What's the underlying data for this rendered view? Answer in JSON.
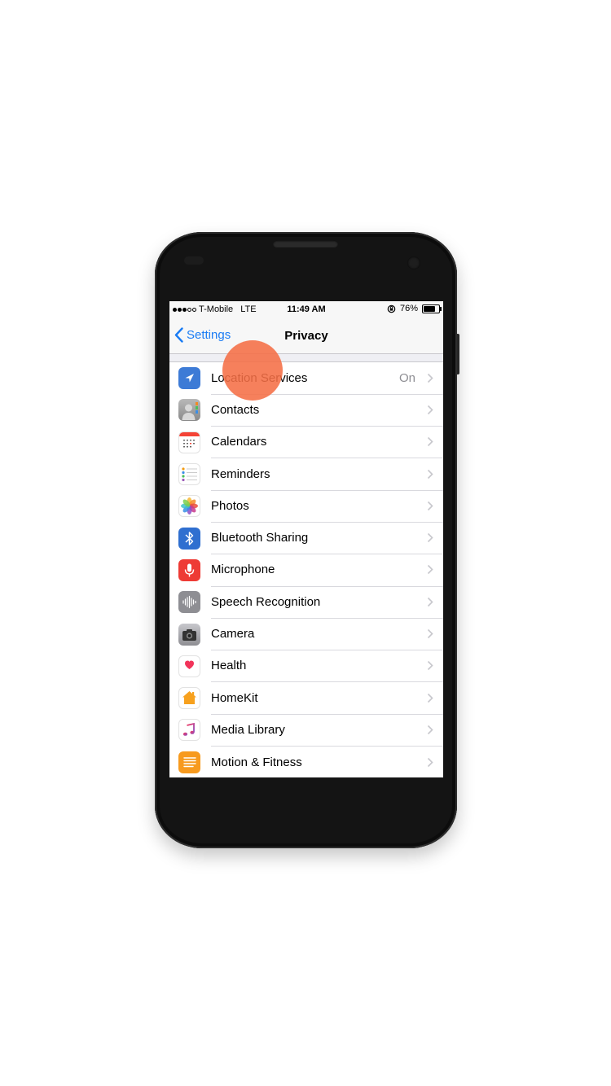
{
  "status_bar": {
    "carrier": "T-Mobile",
    "network": "LTE",
    "time": "11:49 AM",
    "battery": "76%"
  },
  "nav": {
    "back_label": "Settings",
    "title": "Privacy"
  },
  "rows": [
    {
      "label": "Location Services",
      "value": "On",
      "icon": "location-arrow-icon",
      "color": "#3d7bd6"
    },
    {
      "label": "Contacts",
      "value": "",
      "icon": "contacts-icon",
      "color": "#9b9b9b"
    },
    {
      "label": "Calendars",
      "value": "",
      "icon": "calendar-icon",
      "color": "#ffffff"
    },
    {
      "label": "Reminders",
      "value": "",
      "icon": "reminders-icon",
      "color": "#ffffff"
    },
    {
      "label": "Photos",
      "value": "",
      "icon": "photos-icon",
      "color": "#ffffff"
    },
    {
      "label": "Bluetooth Sharing",
      "value": "",
      "icon": "bluetooth-icon",
      "color": "#2f6fd0"
    },
    {
      "label": "Microphone",
      "value": "",
      "icon": "microphone-icon",
      "color": "#ee3b35"
    },
    {
      "label": "Speech Recognition",
      "value": "",
      "icon": "speech-waveform-icon",
      "color": "#8e8e93"
    },
    {
      "label": "Camera",
      "value": "",
      "icon": "camera-icon",
      "color": "#9a9a9f"
    },
    {
      "label": "Health",
      "value": "",
      "icon": "health-heart-icon",
      "color": "#ffffff"
    },
    {
      "label": "HomeKit",
      "value": "",
      "icon": "home-icon",
      "color": "#ffffff"
    },
    {
      "label": "Media Library",
      "value": "",
      "icon": "music-note-icon",
      "color": "#ffffff"
    },
    {
      "label": "Motion & Fitness",
      "value": "",
      "icon": "motion-fitness-icon",
      "color": "#f79a1e"
    }
  ]
}
